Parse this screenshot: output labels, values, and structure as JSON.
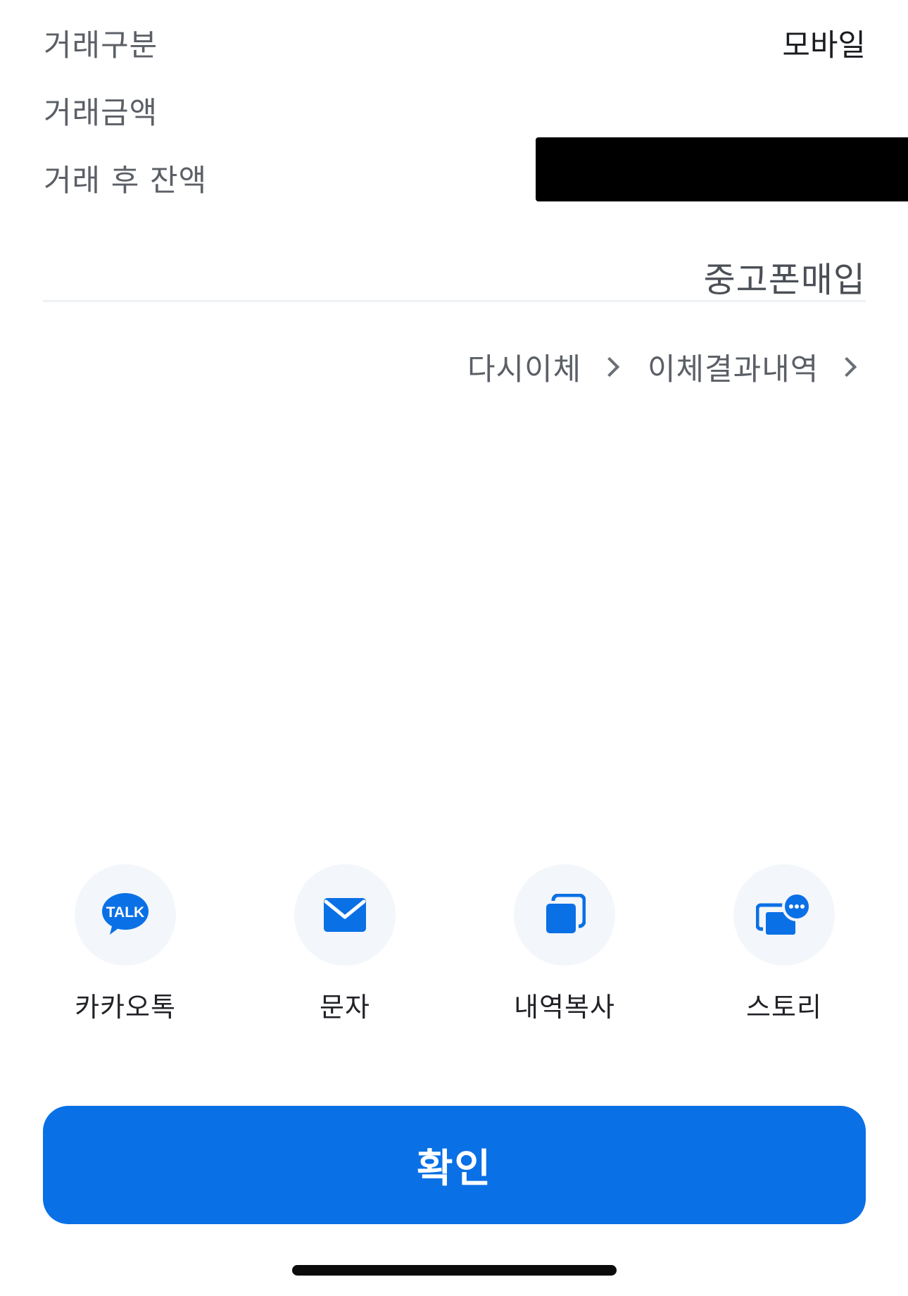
{
  "details": {
    "rows": [
      {
        "label": "거래구분",
        "value": "모바일"
      },
      {
        "label": "거래금액",
        "value": ""
      },
      {
        "label": "거래 후 잔액",
        "value": ""
      }
    ],
    "memo": "중고폰매입"
  },
  "links": {
    "retransfer": "다시이체",
    "history": "이체결과내역"
  },
  "share": {
    "items": [
      {
        "label": "카카오톡",
        "icon": "kakaotalk-icon",
        "badge": "TALK"
      },
      {
        "label": "문자",
        "icon": "mail-icon"
      },
      {
        "label": "내역복사",
        "icon": "copy-icon"
      },
      {
        "label": "스토리",
        "icon": "story-icon"
      }
    ]
  },
  "confirm": {
    "label": "확인"
  },
  "colors": {
    "primary": "#0a70e6",
    "circle_bg": "#f3f6fa",
    "label_gray": "#5b5f66"
  }
}
